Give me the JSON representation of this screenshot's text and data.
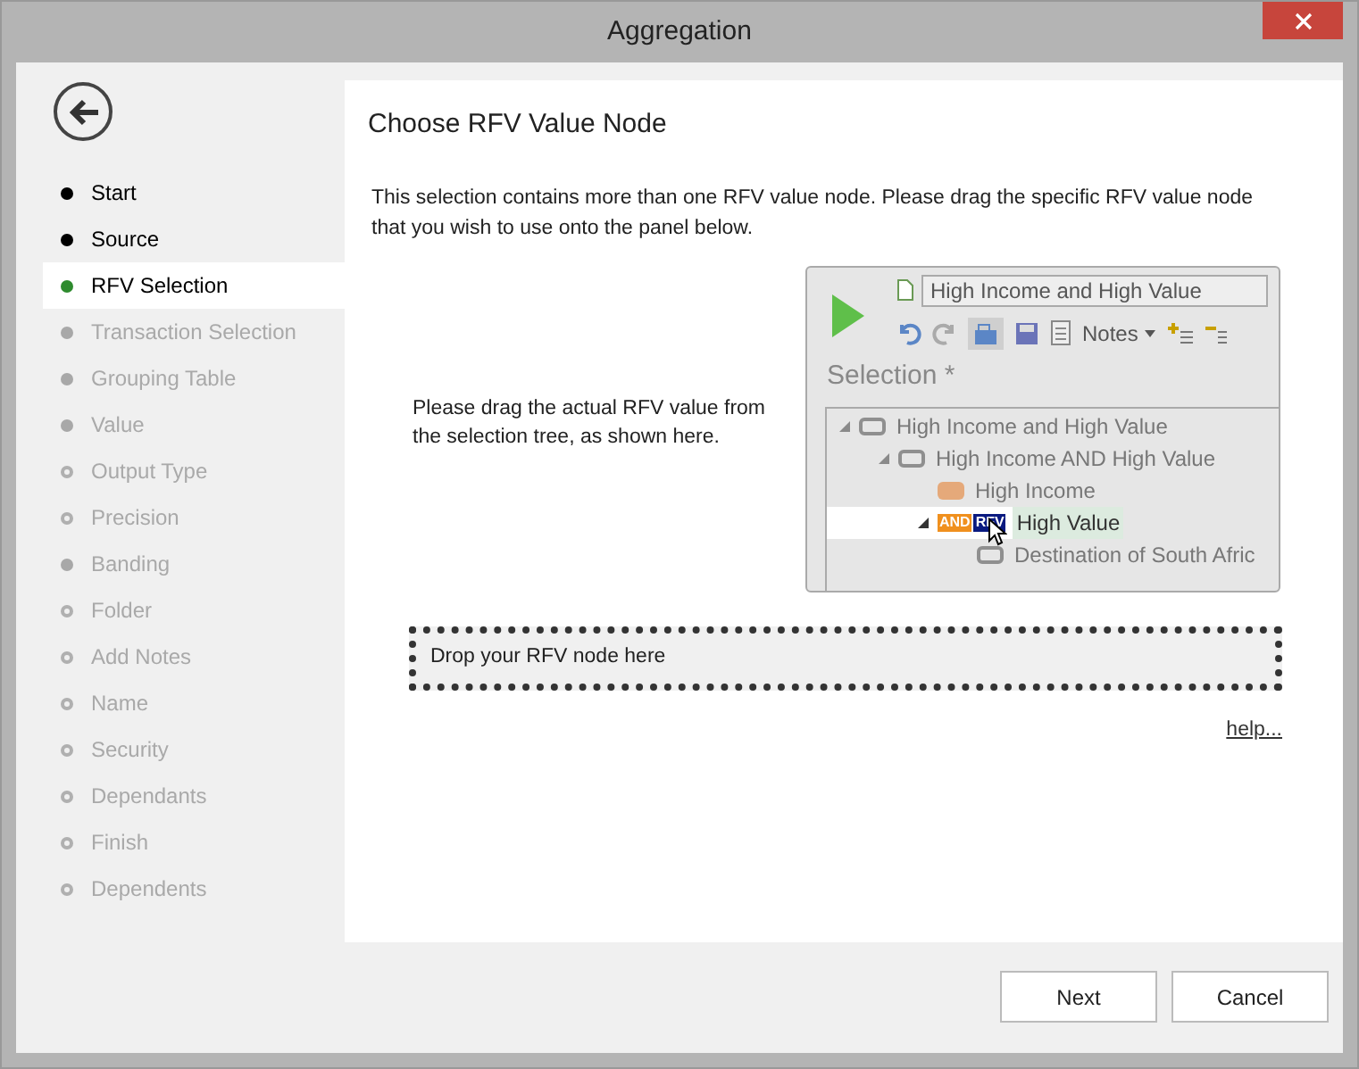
{
  "window": {
    "title": "Aggregation"
  },
  "steps": [
    {
      "label": "Start",
      "kind": "done",
      "selected": false
    },
    {
      "label": "Source",
      "kind": "done",
      "selected": false
    },
    {
      "label": "RFV Selection",
      "kind": "current",
      "selected": true
    },
    {
      "label": "Transaction Selection",
      "kind": "available",
      "selected": false
    },
    {
      "label": "Grouping Table",
      "kind": "available",
      "selected": false
    },
    {
      "label": "Value",
      "kind": "available",
      "selected": false
    },
    {
      "label": "Output Type",
      "kind": "pending",
      "selected": false
    },
    {
      "label": "Precision",
      "kind": "pending",
      "selected": false
    },
    {
      "label": "Banding",
      "kind": "available",
      "selected": false
    },
    {
      "label": "Folder",
      "kind": "pending",
      "selected": false
    },
    {
      "label": "Add Notes",
      "kind": "pending",
      "selected": false
    },
    {
      "label": "Name",
      "kind": "pending",
      "selected": false
    },
    {
      "label": "Security",
      "kind": "pending",
      "selected": false
    },
    {
      "label": "Dependants",
      "kind": "pending",
      "selected": false
    },
    {
      "label": "Finish",
      "kind": "pending",
      "selected": false
    },
    {
      "label": "Dependents",
      "kind": "pending",
      "selected": false
    }
  ],
  "page": {
    "heading": "Choose RFV Value Node",
    "intro": "This selection contains more than one RFV value node. Please drag the specific RFV value node that you wish to use onto the panel below.",
    "hint": "Please drag the actual RFV value from the selection tree, as shown here."
  },
  "example": {
    "title_field": "High Income and High Value",
    "notes_button": "Notes",
    "heading": "Selection *",
    "tree": [
      {
        "label": "High Income and High Value",
        "kind": "outline",
        "expanded": true,
        "selected": false,
        "children": [
          {
            "label": "High Income AND High Value",
            "kind": "outline",
            "expanded": true,
            "selected": false,
            "children": [
              {
                "label": "High Income",
                "kind": "filled",
                "selected": false
              },
              {
                "label": "High Value",
                "kind": "badges",
                "badges": [
                  "AND",
                  "RFV"
                ],
                "expanded": true,
                "selected": true,
                "children": [
                  {
                    "label": "Destination of South Afric",
                    "kind": "outline",
                    "selected": false
                  }
                ]
              }
            ]
          }
        ]
      }
    ]
  },
  "drop_zone": {
    "text": "Drop your RFV node here"
  },
  "help_link": "help...",
  "buttons": [
    "Next",
    "Cancel"
  ]
}
